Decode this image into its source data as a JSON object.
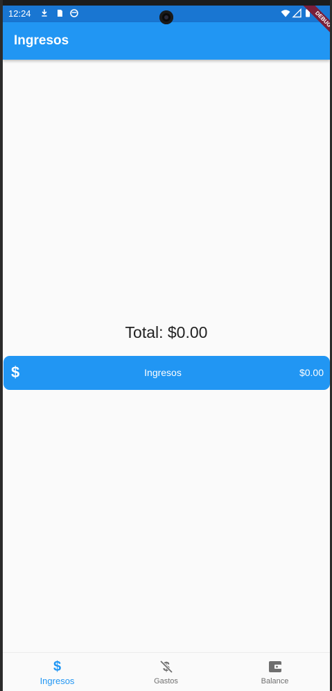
{
  "status_bar": {
    "time": "12:24",
    "icons": [
      "download-icon",
      "sim-icon",
      "sync-icon",
      "wifi-icon",
      "signal-icon",
      "battery-icon"
    ]
  },
  "debug_banner": "DEBUG",
  "app_bar": {
    "title": "Ingresos"
  },
  "summary": {
    "total_text": "Total: $0.00"
  },
  "income_card": {
    "icon": "dollar-icon",
    "label": "Ingresos",
    "amount": "$0.00"
  },
  "bottom_nav": {
    "items": [
      {
        "label": "Ingresos",
        "icon": "dollar-icon",
        "active": true
      },
      {
        "label": "Gastos",
        "icon": "money-off-icon",
        "active": false
      },
      {
        "label": "Balance",
        "icon": "wallet-icon",
        "active": false
      }
    ]
  },
  "colors": {
    "primary": "#2196f3",
    "status_bar": "#1976d2",
    "background": "#fafafa",
    "inactive_nav": "#6f6f6f"
  }
}
